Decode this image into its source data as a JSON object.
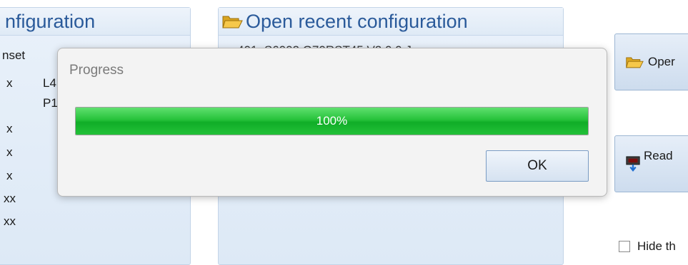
{
  "left_panel": {
    "title": "nfiguration",
    "items": [
      {
        "col1": "nset",
        "col2": ""
      },
      {
        "col1": "x",
        "col2": "L4"
      },
      {
        "col1": "",
        "col2": "P1"
      },
      {
        "col1": "x",
        "col2": ""
      },
      {
        "col1": "x",
        "col2": ""
      },
      {
        "col1": "x",
        "col2": ""
      },
      {
        "col1": "xx",
        "col2": ""
      },
      {
        "col1": "xx",
        "col2": ""
      }
    ]
  },
  "mid_panel": {
    "title": "Open recent configuration",
    "partial_entry": "401_S6002 G70RST45 V2.0.0.J"
  },
  "side_buttons": {
    "open_label": "Oper",
    "read_label": "Read"
  },
  "hide_label": "Hide th",
  "dialog": {
    "title": "Progress",
    "progress_value": 100,
    "progress_text": "100%",
    "ok_label": "OK"
  },
  "colors": {
    "accent": "#2a5a9a",
    "progress_green": "#1fbf36"
  },
  "icons": {
    "folder": "folder-open-icon",
    "read": "download-chip-icon"
  }
}
